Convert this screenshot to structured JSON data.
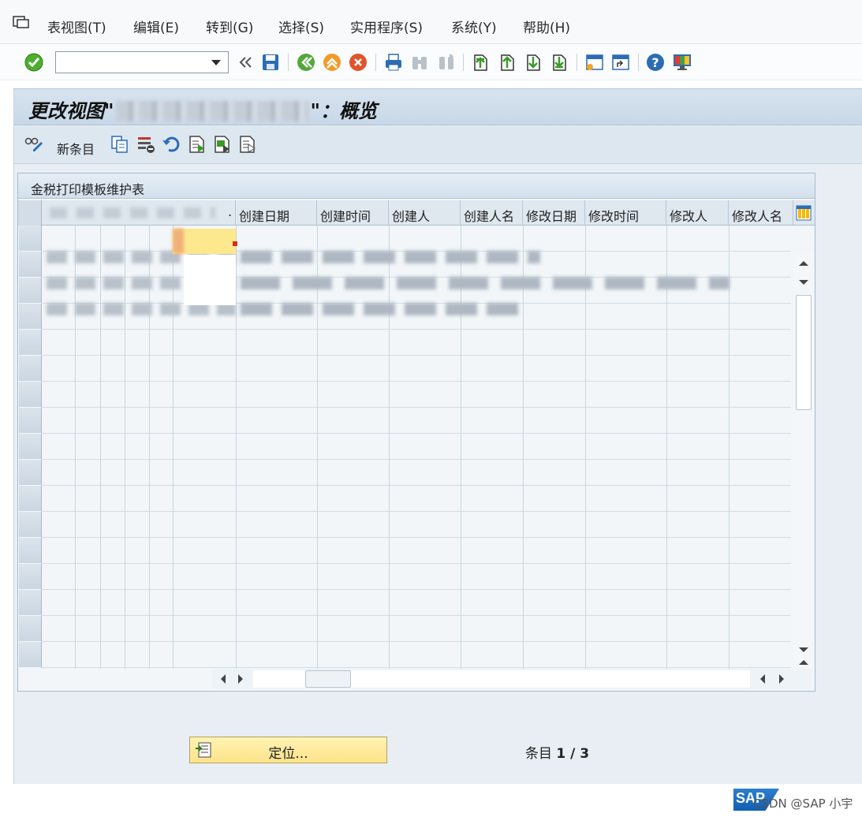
{
  "menu": {
    "items": [
      "表视图(T)",
      "编辑(E)",
      "转到(G)",
      "选择(S)",
      "实用程序(S)",
      "系统(Y)",
      "帮助(H)"
    ]
  },
  "toolbar": {
    "command_value": "",
    "icons": [
      "enter-icon",
      "back-icon",
      "save-icon",
      "back-green-icon",
      "exit-icon",
      "cancel-icon",
      "print-icon",
      "find-icon",
      "find-next-icon",
      "first-page-icon",
      "prev-page-icon",
      "next-page-icon",
      "last-page-icon",
      "create-session-icon",
      "shortcut-icon",
      "help-icon",
      "layout-icon"
    ]
  },
  "screen": {
    "title_prefix": "更改视图\"",
    "title_suffix": "\"：概览",
    "app_toolbar": {
      "new_entries_label": "新条目"
    },
    "table": {
      "title": "金税打印模板维护表",
      "columns": [
        ".",
        "创建日期",
        "创建时间",
        "创建人",
        "创建人名",
        "修改日期",
        "修改时间",
        "修改人",
        "修改人名"
      ],
      "visible_rows": 17
    },
    "position_button_label": "定位...",
    "entry_label": "条目",
    "entry_value": "1 / 3"
  },
  "footer": {
    "sap_logo": "SAP",
    "watermark": "CSDN @SAP 小宇"
  },
  "colors": {
    "accent_blue": "#c8d8e8",
    "button_yellow": "#fde38a",
    "selected_cell": "#fde88e"
  }
}
